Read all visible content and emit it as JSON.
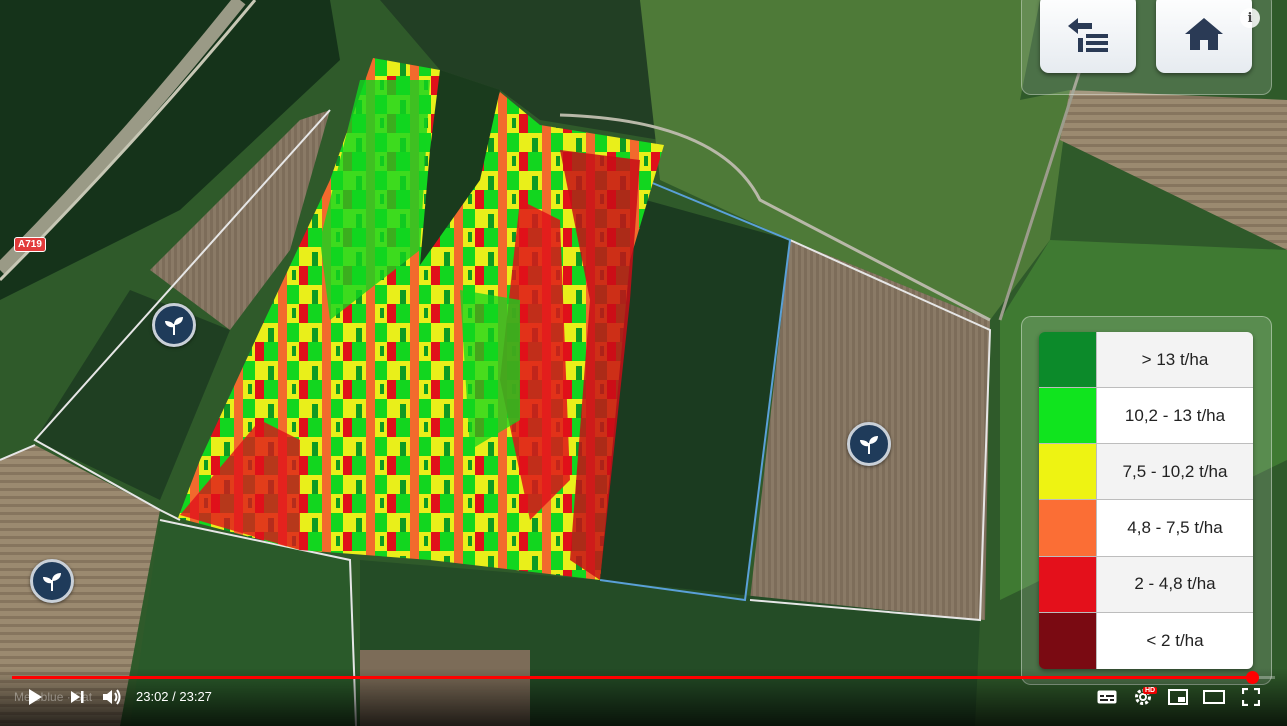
{
  "map": {
    "road_label": "A719",
    "watermark": "Meteblue · Sat"
  },
  "nav": {
    "back_icon": "list-back-icon",
    "home_icon": "home-icon",
    "info_label": "i"
  },
  "markers": [
    {
      "icon": "seedling-icon"
    },
    {
      "icon": "seedling-icon"
    },
    {
      "icon": "seedling-icon"
    }
  ],
  "legend": {
    "items": [
      {
        "label": "> 13 t/ha",
        "color": "#0c8a2a"
      },
      {
        "label": "10,2 - 13 t/ha",
        "color": "#10e41e"
      },
      {
        "label": "7,5 - 10,2 t/ha",
        "color": "#eef312"
      },
      {
        "label": "4,8 - 7,5 t/ha",
        "color": "#fb6e35"
      },
      {
        "label": "2 - 4,8 t/ha",
        "color": "#e4101b"
      },
      {
        "label": "< 2 t/ha",
        "color": "#7a0a12"
      }
    ]
  },
  "player": {
    "time": "23:02 / 23:27",
    "progress": 0.982,
    "hd_label": "HD",
    "icons": [
      "play-icon",
      "next-icon",
      "volume-icon",
      "subtitles-icon",
      "settings-icon",
      "miniplayer-icon",
      "theater-icon",
      "fullscreen-icon"
    ]
  }
}
